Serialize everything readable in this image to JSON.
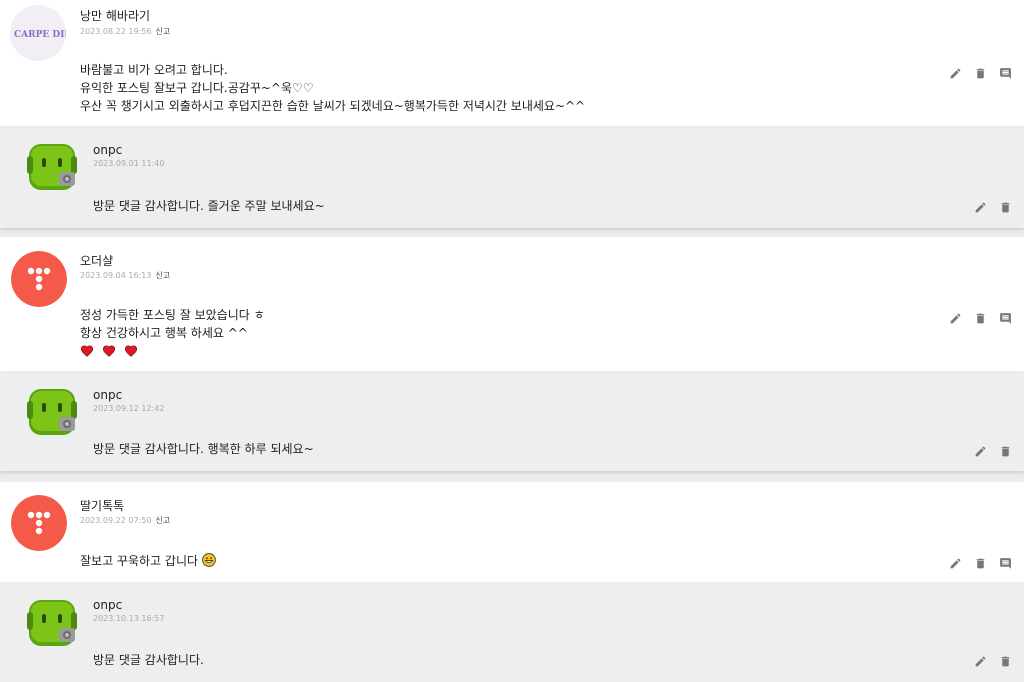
{
  "comments": [
    {
      "author": "낭만 해바라기",
      "date": "2023.08.22 19:56",
      "report": "신고",
      "avatar_text": "CARPE DIEM",
      "lines": [
        "바람불고 비가 오려고 합니다.",
        "유익한 포스팅 잘보구 갑니다.공감꾸~^욱♡♡",
        "우산 꼭 챙기시고 외출하시고 후덥지끈한 습한 날씨가 되겠네요~행복가득한 저녁시간 보내세요~^^"
      ],
      "reply": {
        "author": "onpc",
        "date": "2023.09.01 11:40",
        "text": "방문 댓글 감사합니다. 즐거운 주말 보내세요~"
      }
    },
    {
      "author": "오더샬",
      "date": "2023.09.04 16:13",
      "report": "신고",
      "lines": [
        "정성 가득한 포스팅 잘 보았습니다 ㅎ",
        "항상 건강하시고 행복 하세요 ^^"
      ],
      "hearts": 3,
      "reply": {
        "author": "onpc",
        "date": "2023.09.12 12:42",
        "text": "방문 댓글 감사합니다. 행복한 하루 되세요~"
      }
    },
    {
      "author": "딸기톡톡",
      "date": "2023.09.22 07:50",
      "report": "신고",
      "text": "잘보고 꾸욱하고 갑니다",
      "reply": {
        "author": "onpc",
        "date": "2023.10.13 16:57",
        "text": "방문 댓글 감사합니다."
      }
    }
  ],
  "icons": {
    "edit": "pencil-icon",
    "delete": "trash-icon",
    "reply": "comment-icon"
  },
  "colors": {
    "accent_red": "#f4594a",
    "android_green": "#7cc417",
    "heart": "#d91a2a"
  }
}
